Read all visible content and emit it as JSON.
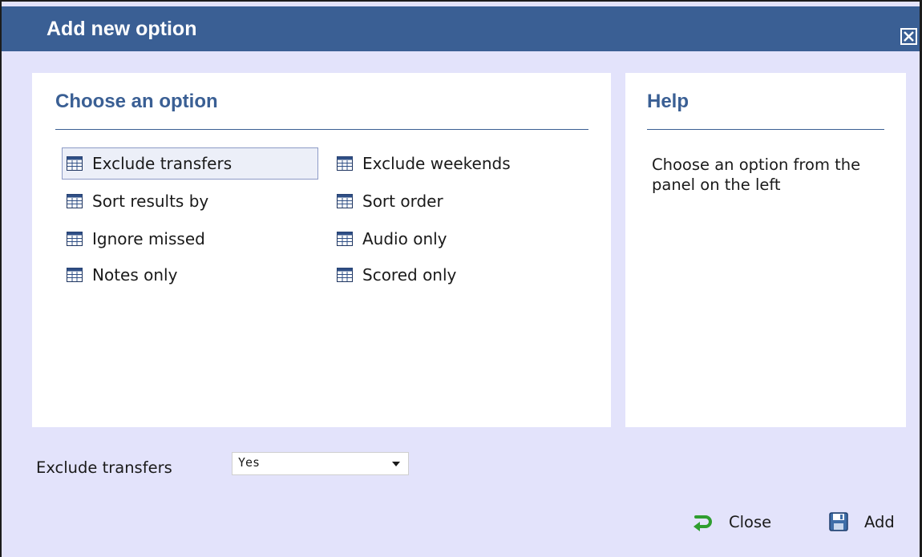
{
  "dialog": {
    "title": "Add new option",
    "close_icon": "close-x-icon"
  },
  "options_panel": {
    "title": "Choose an option",
    "items": [
      {
        "label": "Exclude transfers",
        "icon": "table-icon",
        "selected": true
      },
      {
        "label": "Exclude weekends",
        "icon": "table-icon",
        "selected": false
      },
      {
        "label": "Sort results by",
        "icon": "table-icon",
        "selected": false
      },
      {
        "label": "Sort order",
        "icon": "table-icon",
        "selected": false
      },
      {
        "label": "Ignore missed",
        "icon": "table-icon",
        "selected": false
      },
      {
        "label": "Audio only",
        "icon": "table-icon",
        "selected": false
      },
      {
        "label": "Notes only",
        "icon": "table-icon",
        "selected": false
      },
      {
        "label": "Scored only",
        "icon": "table-icon",
        "selected": false
      }
    ]
  },
  "help_panel": {
    "title": "Help",
    "text": "Choose an option from the panel on the left"
  },
  "setting": {
    "label": "Exclude transfers",
    "value": "Yes"
  },
  "actions": {
    "close_label": "Close",
    "close_icon": "green-return-arrow-icon",
    "add_label": "Add",
    "add_icon": "floppy-disk-icon"
  },
  "colors": {
    "titlebar": "#3a5f94",
    "dialog_bg": "#e3e3fb",
    "heading": "#3a5f94",
    "selection_border": "#8d9bc6"
  }
}
